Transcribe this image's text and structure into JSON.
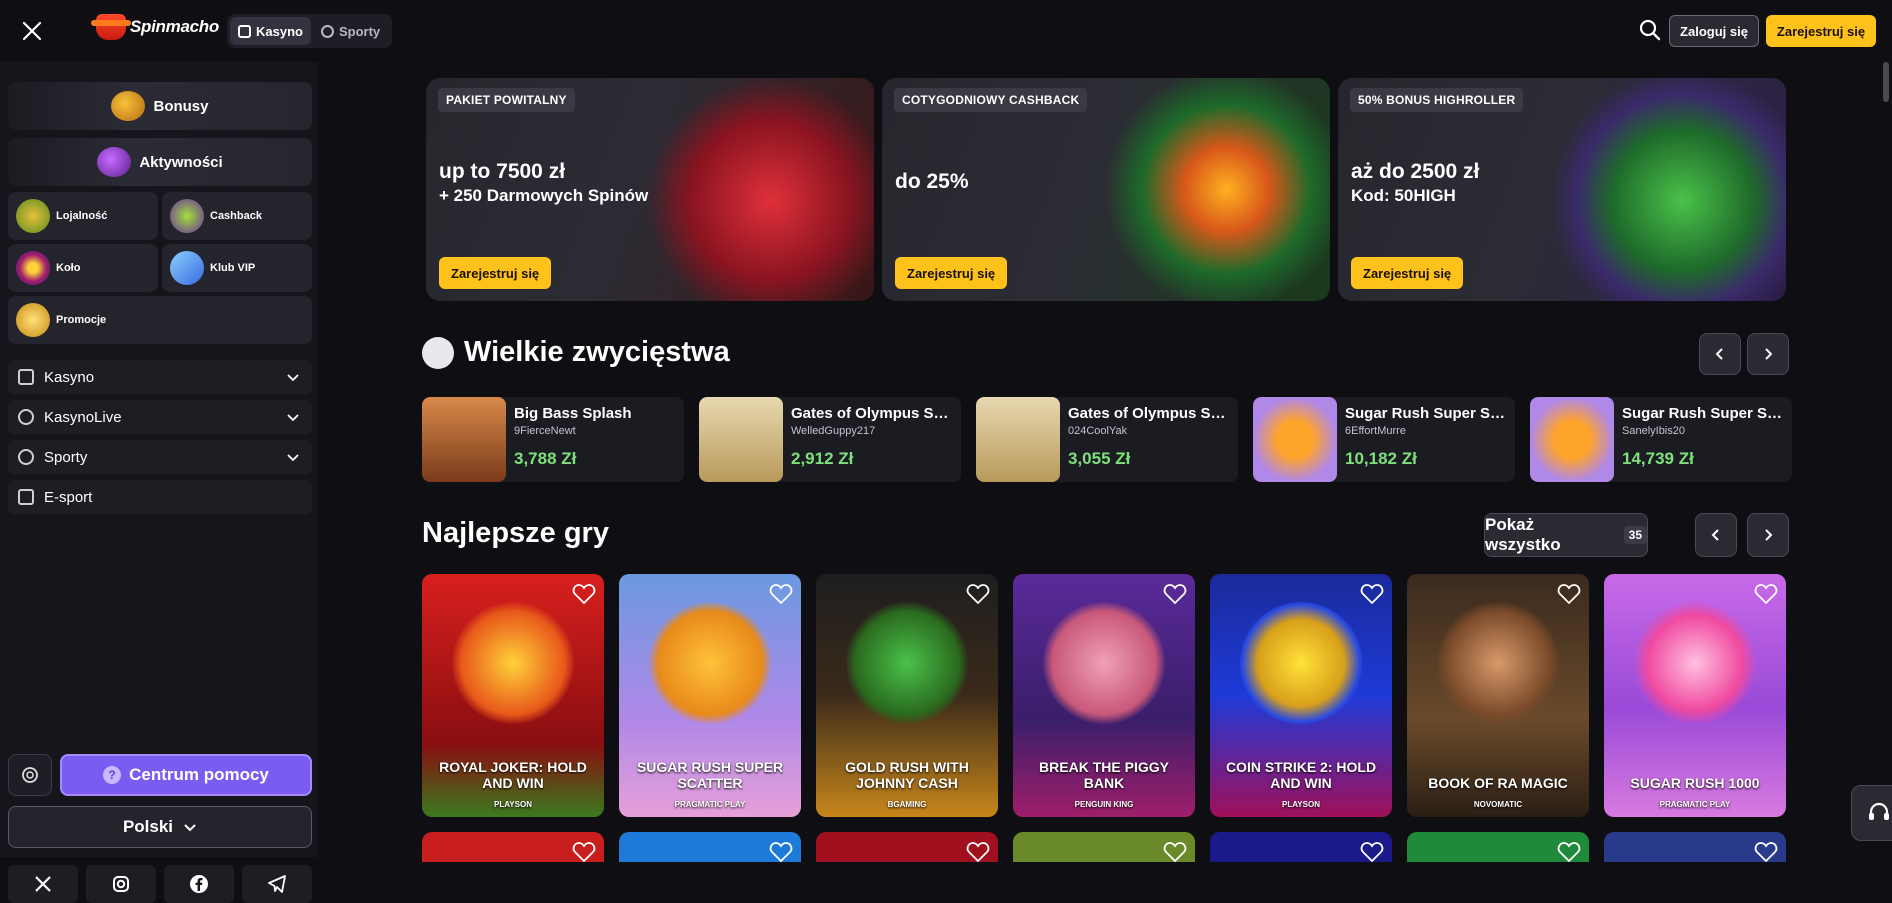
{
  "header": {
    "brand": "Spinmacho",
    "segments": [
      {
        "label": "Kasyno",
        "icon": "casino-icon",
        "active": true
      },
      {
        "label": "Sporty",
        "icon": "sports-icon",
        "active": false
      }
    ],
    "login_label": "Zaloguj się",
    "register_label": "Zarejestruj się",
    "accent": "#ffc21a"
  },
  "sidebar": {
    "big_tiles": [
      {
        "label": "Bonusy",
        "icon": "bonus-hat-icon"
      },
      {
        "label": "Aktywności",
        "icon": "activities-icon"
      }
    ],
    "small_tiles": [
      {
        "label": "Lojalność",
        "icon": "loyalty-icon"
      },
      {
        "label": "Cashback",
        "icon": "cashback-icon"
      },
      {
        "label": "Koło",
        "icon": "wheel-icon"
      },
      {
        "label": "Klub VIP",
        "icon": "vip-icon"
      },
      {
        "label": "Promocje",
        "icon": "promotions-icon"
      }
    ],
    "nav": [
      {
        "label": "Kasyno",
        "icon": "casino-icon",
        "expandable": true
      },
      {
        "label": "KasynoLive",
        "icon": "live-icon",
        "expandable": true
      },
      {
        "label": "Sporty",
        "icon": "sports-icon",
        "expandable": true
      },
      {
        "label": "E-sport",
        "icon": "gamepad-icon",
        "expandable": false
      }
    ],
    "help_label": "Centrum pomocy",
    "language": "Polski",
    "socials": [
      "x-icon",
      "instagram-icon",
      "facebook-icon",
      "telegram-icon"
    ]
  },
  "promos": [
    {
      "tag": "PAKIET POWITALNY",
      "headline": "up to 7500 zł",
      "sub": "+ 250 Darmowych Spinów",
      "cta": "Zarejestruj się"
    },
    {
      "tag": "COTYGODNIOWY CASHBACK",
      "headline": "do 25%",
      "sub": "",
      "cta": "Zarejestruj się"
    },
    {
      "tag": "50% BONUS HIGHROLLER",
      "headline": "aż do 2500 zł",
      "sub": "Kod: 50HIGH",
      "cta": "Zarejestruj się"
    }
  ],
  "big_wins": {
    "title": "Wielkie zwycięstwa",
    "items": [
      {
        "game": "Big Bass Splash",
        "user": "9FierceNewt",
        "amount": "3,788 Zł"
      },
      {
        "game": "Gates of Olympus Super Scatter",
        "user": "WelledGuppy217",
        "amount": "2,912 Zł"
      },
      {
        "game": "Gates of Olympus Super Scatter",
        "user": "024CoolYak",
        "amount": "3,055 Zł"
      },
      {
        "game": "Sugar Rush Super Scatter",
        "user": "6EffortMurre",
        "amount": "10,182 Zł"
      },
      {
        "game": "Sugar Rush Super Scatter",
        "user": "SanelyIbis20",
        "amount": "14,739 Zł"
      }
    ]
  },
  "top_games": {
    "title": "Najlepsze gry",
    "show_all_label": "Pokaż wszystko",
    "count": "35",
    "games": [
      {
        "name": "Royal Joker: Hold and Win",
        "provider": "Playson"
      },
      {
        "name": "Sugar Rush Super Scatter",
        "provider": "Pragmatic Play"
      },
      {
        "name": "Gold Rush With Johnny Cash",
        "provider": "BGaming"
      },
      {
        "name": "Break the Piggy Bank",
        "provider": "Penguin King"
      },
      {
        "name": "Coin Strike 2: Hold and Win",
        "provider": "Playson"
      },
      {
        "name": "Book of Ra Magic",
        "provider": "Novomatic"
      },
      {
        "name": "Sugar Rush 1000",
        "provider": "Pragmatic Play"
      }
    ]
  }
}
